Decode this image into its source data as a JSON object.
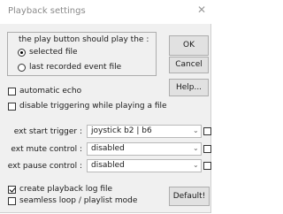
{
  "window": {
    "title": "Playback settings",
    "close_glyph": "✕"
  },
  "play_button_group": {
    "label": "the play button should play the :",
    "options": [
      {
        "label": "selected file",
        "selected": true
      },
      {
        "label": "last recorded event file",
        "selected": false
      }
    ]
  },
  "buttons": {
    "ok": "OK",
    "cancel": "Cancel",
    "help": "Help...",
    "default": "Default!"
  },
  "checkboxes": {
    "automatic_echo": {
      "label": "automatic echo",
      "checked": false
    },
    "disable_triggering": {
      "label": "disable triggering while playing a file",
      "checked": false
    },
    "create_log": {
      "label": "create playback log file",
      "checked": true
    },
    "seamless_loop": {
      "label": "seamless loop / playlist mode",
      "checked": false
    }
  },
  "fields": {
    "start_trigger": {
      "label": "ext start trigger :",
      "value": "joystick b2 | b6",
      "checked": false
    },
    "mute_control": {
      "label": "ext mute control :",
      "value": "disabled",
      "checked": false
    },
    "pause_control": {
      "label": "ext pause control :",
      "value": "disabled",
      "checked": false
    }
  }
}
